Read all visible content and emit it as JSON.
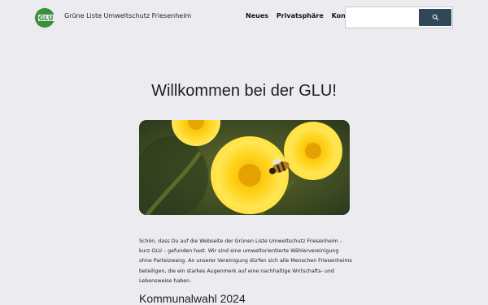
{
  "site": {
    "logo_text": "GLU",
    "title": "Grüne Liste Umweltschutz Friesenheim"
  },
  "nav": {
    "items": [
      {
        "label": "Neues"
      },
      {
        "label": "Privatsphäre"
      },
      {
        "label": "Kontakt"
      }
    ]
  },
  "search": {
    "placeholder": "",
    "button_icon": "search-icon"
  },
  "main": {
    "heading": "Willkommen bei der GLU!",
    "hero_image": "dandelion-flowers-with-bee",
    "intro": "Schön, dass Du auf die Webseite der Grünen Liste Umweltschutz Friesenheim – kurz GLU – gefunden hast. Wir sind eine umweltorientierte Wählervereinigung ohne Parteizwang. An unserer Vereinigung dürfen sich alle Menschen Friesenheims beteiligen, die ein starkes Augenmerk auf eine nachhaltige Wirtschafts- und Lebensweise haben.",
    "subheading": "Kommunalwahl 2024"
  },
  "colors": {
    "background": "#ececf0",
    "brand_green": "#3a8f3a",
    "search_button": "#2f4756"
  }
}
